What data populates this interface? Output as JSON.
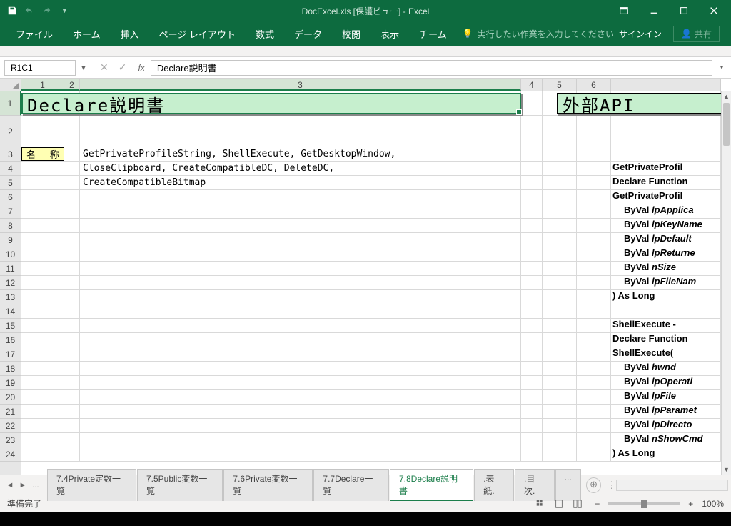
{
  "titlebar": {
    "title": "DocExcel.xls [保護ビュー] - Excel"
  },
  "ribbon": {
    "tabs": [
      "ファイル",
      "ホーム",
      "挿入",
      "ページ レイアウト",
      "数式",
      "データ",
      "校閲",
      "表示",
      "チーム"
    ],
    "tellme": "実行したい作業を入力してください",
    "signin": "サインイン",
    "share": "共有"
  },
  "formula_bar": {
    "name_box": "R1C1",
    "formula": "Declare説明書"
  },
  "columns": [
    "1",
    "2",
    "3",
    "4",
    "5",
    "6"
  ],
  "rows": [
    "1",
    "2",
    "3",
    "4",
    "5",
    "6",
    "7",
    "8",
    "9",
    "10",
    "11",
    "12",
    "13",
    "14",
    "15",
    "16",
    "17",
    "18",
    "19",
    "20",
    "21",
    "22",
    "23",
    "24"
  ],
  "cells": {
    "title_main": "Declare説明書",
    "title_api": "外部API",
    "label_name": "名 称",
    "r3c3": "GetPrivateProfileString, ShellExecute, GetDesktopWindow,",
    "r4c3": "CloseClipboard, CreateCompatibleDC, DeleteDC,",
    "r5c3": "CreateCompatibleBitmap"
  },
  "api_lines": [
    {
      "t": "GetPrivateProfil",
      "i": 0
    },
    {
      "t": "Declare Function",
      "i": 0
    },
    {
      "t": "GetPrivateProfil",
      "i": 0
    },
    {
      "t": "ByVal lpApplica",
      "i": 1,
      "it": 1
    },
    {
      "t": "ByVal lpKeyName",
      "i": 1,
      "it": 1
    },
    {
      "t": "ByVal lpDefault",
      "i": 1,
      "it": 1
    },
    {
      "t": "ByVal lpReturne",
      "i": 1,
      "it": 1
    },
    {
      "t": "ByVal nSize",
      "i": 1,
      "it": 1
    },
    {
      "t": "ByVal lpFileNam",
      "i": 1,
      "it": 1
    },
    {
      "t": ") As Long",
      "i": 0
    },
    {
      "t": "",
      "i": 0
    },
    {
      "t": "ShellExecute - ",
      "i": 0
    },
    {
      "t": "Declare Function",
      "i": 0
    },
    {
      "t": "ShellExecute(",
      "i": 0
    },
    {
      "t": "ByVal hwnd",
      "i": 1,
      "it": 1
    },
    {
      "t": "ByVal lpOperati",
      "i": 1,
      "it": 1
    },
    {
      "t": "ByVal lpFile",
      "i": 1,
      "it": 1
    },
    {
      "t": "ByVal lpParamet",
      "i": 1,
      "it": 1
    },
    {
      "t": "ByVal lpDirecto",
      "i": 1,
      "it": 1
    },
    {
      "t": "ByVal nShowCmd",
      "i": 1,
      "it": 1
    },
    {
      "t": ") As Long",
      "i": 0
    }
  ],
  "sheet_tabs": {
    "tabs": [
      "7.4Private定数一覧",
      "7.5Public変数一覧",
      "7.6Private変数一覧",
      "7.7Declare一覧",
      "7.8Declare説明書",
      ".表紙.",
      ".目次.",
      "..."
    ],
    "active": 4
  },
  "status": {
    "ready": "準備完了",
    "zoom": "100%"
  }
}
